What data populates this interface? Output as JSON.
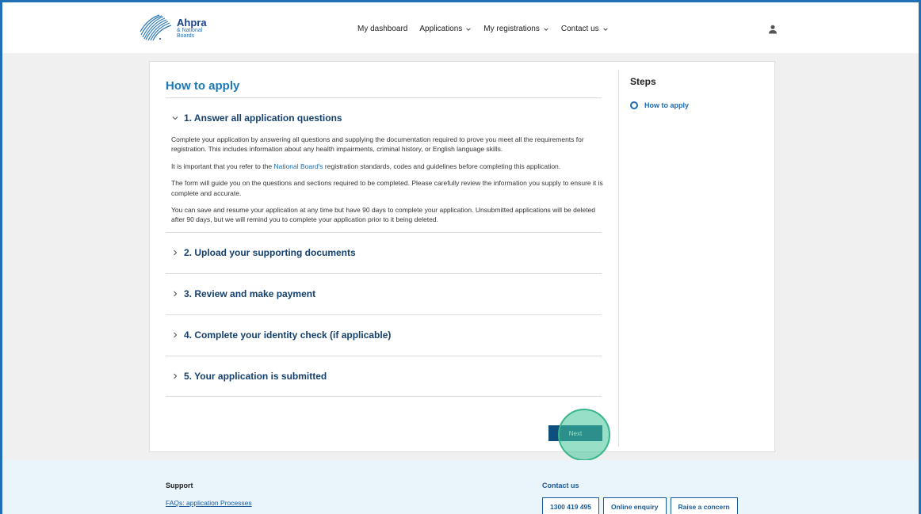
{
  "header": {
    "logo_title": "Ahpra",
    "logo_sub_1": "& National",
    "logo_sub_2": "Boards",
    "nav": [
      {
        "label": "My dashboard",
        "dropdown": false
      },
      {
        "label": "Applications",
        "dropdown": true
      },
      {
        "label": "My registrations",
        "dropdown": true
      },
      {
        "label": "Contact us",
        "dropdown": true
      }
    ]
  },
  "main": {
    "title": "How to apply",
    "open_section": {
      "title": "1. Answer all application questions",
      "p1": "Complete your application by answering all questions and supplying the documentation required to prove you meet all the requirements for registration. This includes information about any health impairments, criminal history, or English language skills.",
      "p2_before": "It is important that you refer to the ",
      "p2_link": "National Board's",
      "p2_after": " registration standards, codes and guidelines before completing this application.",
      "p3": "The form will guide you on the questions and sections required to be completed. Please carefully review the information you supply to ensure it is complete and accurate.",
      "p4": "You can save and resume your application at any time but have 90 days to complete your application. Unsubmitted applications will be deleted after 90 days, but we will remind you to complete your application prior to it being deleted."
    },
    "sections": [
      "2. Upload your supporting documents",
      "3. Review and make payment",
      "4. Complete your identity check (if applicable)",
      "5. Your application is submitted"
    ],
    "next_label": "Next"
  },
  "steps": {
    "title": "Steps",
    "items": [
      "How to apply"
    ]
  },
  "footer": {
    "support_title": "Support",
    "faq_link": "FAQs: application Processes",
    "contact_title": "Contact us",
    "contact_buttons": [
      "1300 419 495",
      "Online enquiry",
      "Raise a concern"
    ]
  },
  "colors": {
    "accent": "#1b79b8",
    "dark_blue": "#14406f",
    "button": "#0f4f7d",
    "footer_bg": "#e9f4fb",
    "frame_border": "#1f6fb6"
  }
}
